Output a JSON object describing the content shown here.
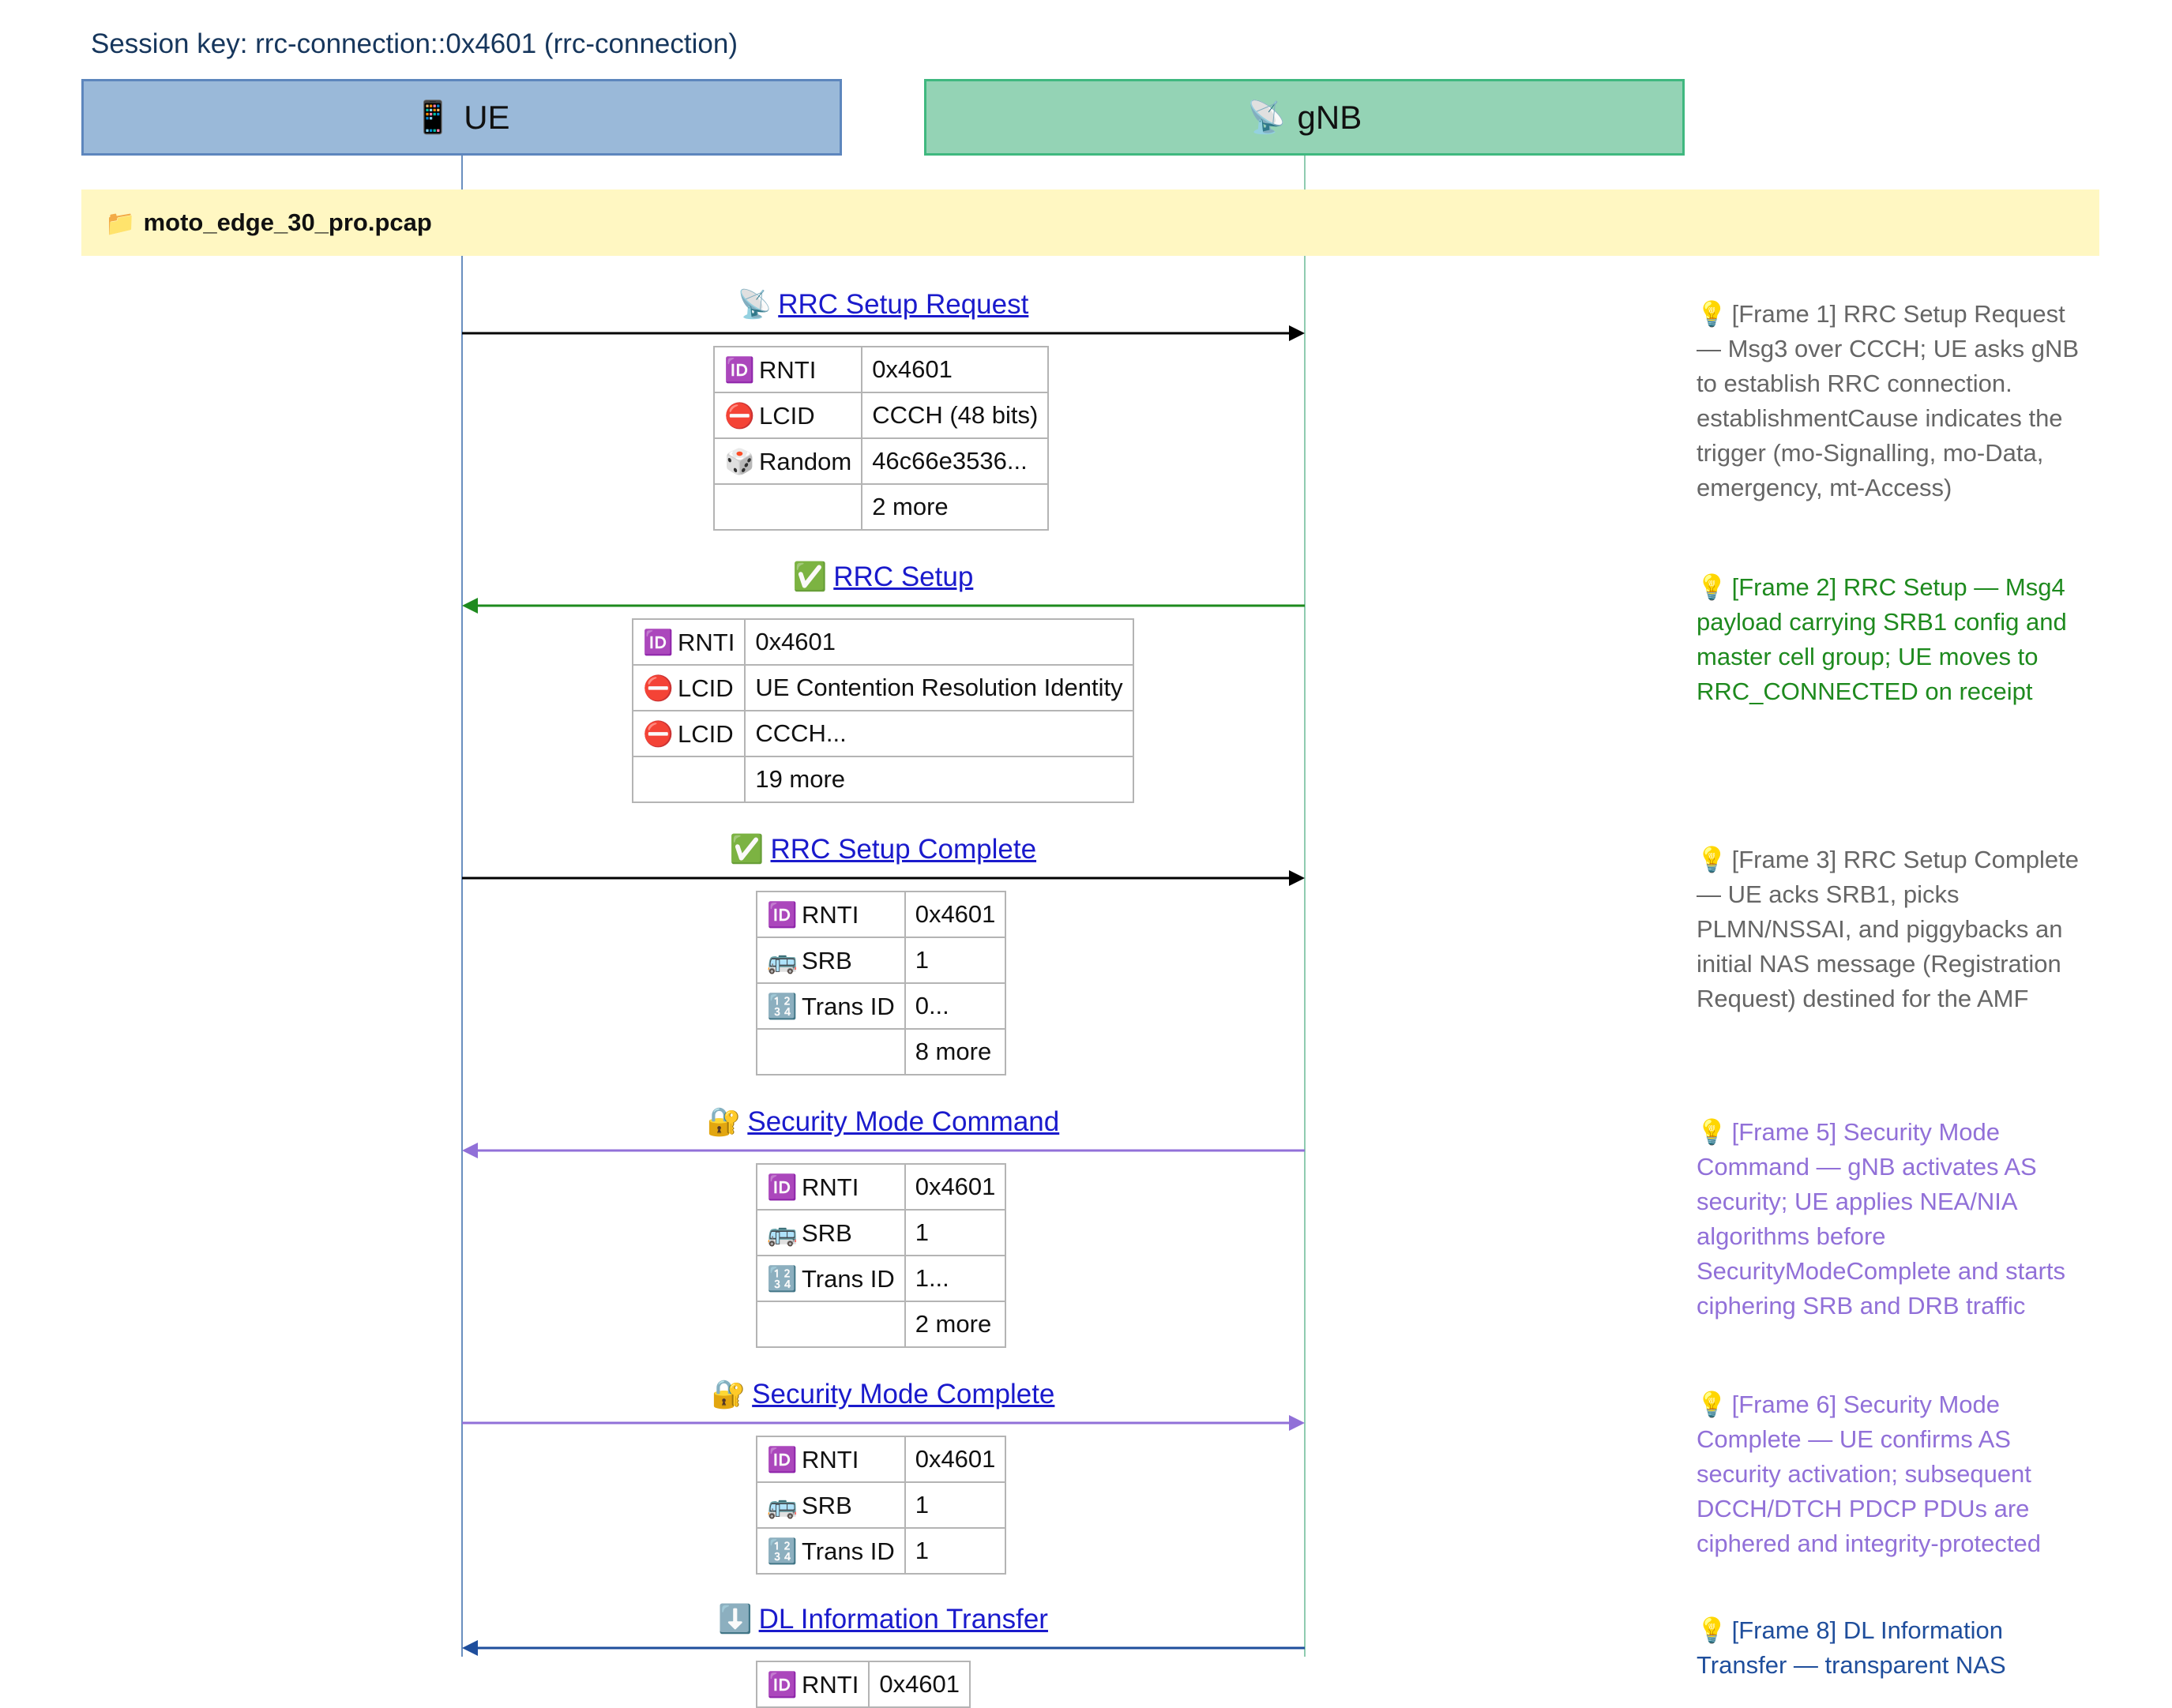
{
  "session_key": "Session key: rrc-connection::0x4601 (rrc-connection)",
  "actors": {
    "ue": {
      "icon": "📱",
      "icon_name": "mobile-phone-icon",
      "label": "UE",
      "color": "#9ab9d9"
    },
    "gnb": {
      "icon": "📡",
      "icon_name": "satellite-antenna-icon",
      "label": "gNB",
      "color": "#94d3b5"
    }
  },
  "file": {
    "icon": "📁",
    "name": "moto_edge_30_pro.pcap"
  },
  "messages": [
    {
      "icon": "📡",
      "title": "RRC Setup Request",
      "direction": "ue_to_gnb",
      "color": "#000000",
      "fields": [
        {
          "icon": "🆔",
          "key": "RNTI",
          "value": "0x4601"
        },
        {
          "icon": "⛔",
          "key": "LCID",
          "value": "CCCH (48 bits)"
        },
        {
          "icon": "🎲",
          "key": "Random",
          "value": "46c66e3536..."
        },
        {
          "icon": "",
          "key": "",
          "value": "2 more"
        }
      ],
      "note": "[Frame 1] RRC Setup Request — Msg3 over CCCH; UE asks gNB to establish RRC connection. establishmentCause indicates the trigger (mo-Signalling, mo-Data, emergency, mt-Access)",
      "note_color": "#666666"
    },
    {
      "icon": "✅",
      "title": "RRC Setup",
      "direction": "gnb_to_ue",
      "color": "#1e8a1e",
      "fields": [
        {
          "icon": "🆔",
          "key": "RNTI",
          "value": "0x4601"
        },
        {
          "icon": "⛔",
          "key": "LCID",
          "value": "UE Contention Resolution Identity"
        },
        {
          "icon": "⛔",
          "key": "LCID",
          "value": "CCCH..."
        },
        {
          "icon": "",
          "key": "",
          "value": "19 more"
        }
      ],
      "note": "[Frame 2] RRC Setup — Msg4 payload carrying SRB1 config and master cell group; UE moves to RRC_CONNECTED on receipt",
      "note_color": "#1e8a1e"
    },
    {
      "icon": "✅",
      "title": "RRC Setup Complete",
      "direction": "ue_to_gnb",
      "color": "#000000",
      "fields": [
        {
          "icon": "🆔",
          "key": "RNTI",
          "value": "0x4601"
        },
        {
          "icon": "🚌",
          "key": "SRB",
          "value": "1"
        },
        {
          "icon": "🔢",
          "key": "Trans ID",
          "value": "0..."
        },
        {
          "icon": "",
          "key": "",
          "value": "8 more"
        }
      ],
      "note": "[Frame 3] RRC Setup Complete — UE acks SRB1, picks PLMN/NSSAI, and piggybacks an initial NAS message (Registration Request) destined for the AMF",
      "note_color": "#666666"
    },
    {
      "icon": "🔐",
      "title": "Security Mode Command",
      "direction": "gnb_to_ue",
      "color": "#9170d8",
      "fields": [
        {
          "icon": "🆔",
          "key": "RNTI",
          "value": "0x4601"
        },
        {
          "icon": "🚌",
          "key": "SRB",
          "value": "1"
        },
        {
          "icon": "🔢",
          "key": "Trans ID",
          "value": "1..."
        },
        {
          "icon": "",
          "key": "",
          "value": "2 more"
        }
      ],
      "note": "[Frame 5] Security Mode Command — gNB activates AS security; UE applies NEA/NIA algorithms before SecurityModeComplete and starts ciphering SRB and DRB traffic",
      "note_color": "#9170d8"
    },
    {
      "icon": "🔐",
      "title": "Security Mode Complete",
      "direction": "ue_to_gnb",
      "color": "#9170d8",
      "fields": [
        {
          "icon": "🆔",
          "key": "RNTI",
          "value": "0x4601"
        },
        {
          "icon": "🚌",
          "key": "SRB",
          "value": "1"
        },
        {
          "icon": "🔢",
          "key": "Trans ID",
          "value": "1"
        }
      ],
      "note": "[Frame 6] Security Mode Complete — UE confirms AS security activation; subsequent DCCH/DTCH PDCP PDUs are ciphered and integrity-protected",
      "note_color": "#9170d8"
    },
    {
      "icon": "⬇️",
      "title": "DL Information Transfer",
      "direction": "gnb_to_ue",
      "color": "#1f4e9c",
      "fields": [
        {
          "icon": "🆔",
          "key": "RNTI",
          "value": "0x4601"
        }
      ],
      "note": "[Frame 8] DL Information Transfer — transparent NAS",
      "note_color": "#1f4e9c"
    }
  ]
}
